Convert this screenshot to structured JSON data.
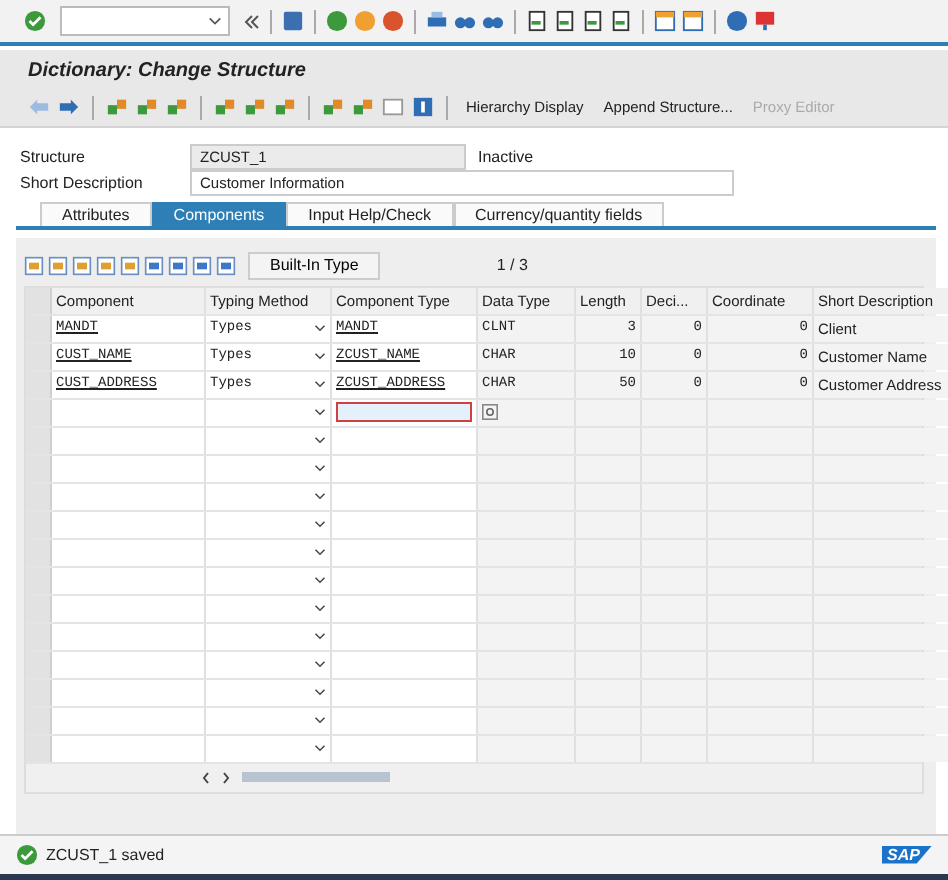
{
  "screen_title": "Dictionary: Change Structure",
  "app_toolbar": [
    {
      "label": "Hierarchy Display",
      "disabled": false
    },
    {
      "label": "Append Structure...",
      "disabled": false
    },
    {
      "label": "Proxy Editor",
      "disabled": true
    }
  ],
  "structure": {
    "label": "Structure",
    "value": "ZCUST_1",
    "status": "Inactive"
  },
  "short_description": {
    "label": "Short Description",
    "value": "Customer Information"
  },
  "tabs": [
    {
      "label": "Attributes",
      "selected": false
    },
    {
      "label": "Components",
      "selected": true
    },
    {
      "label": "Input Help/Check",
      "selected": false
    },
    {
      "label": "Currency/quantity fields",
      "selected": false
    }
  ],
  "builtin_type_button": "Built-In Type",
  "page_indicator": "1 / 3",
  "table": {
    "columns": [
      "Component",
      "Typing Method",
      "Component Type",
      "Data Type",
      "Length",
      "Deci...",
      "Coordinate",
      "Short Description"
    ],
    "rows": [
      {
        "component": "MANDT",
        "typing_method": "Types",
        "component_type": "MANDT",
        "data_type": "CLNT",
        "length": "3",
        "decimals": "0",
        "coordinate": "0",
        "short_description": "Client"
      },
      {
        "component": "CUST_NAME",
        "typing_method": "Types",
        "component_type": "ZCUST_NAME",
        "data_type": "CHAR",
        "length": "10",
        "decimals": "0",
        "coordinate": "0",
        "short_description": "Customer Name"
      },
      {
        "component": "CUST_ADDRESS",
        "typing_method": "Types",
        "component_type": "ZCUST_ADDRESS",
        "data_type": "CHAR",
        "length": "50",
        "decimals": "0",
        "coordinate": "0",
        "short_description": "Customer Address"
      }
    ]
  },
  "status_bar": {
    "message": "ZCUST_1 saved",
    "logo": "SAP"
  }
}
